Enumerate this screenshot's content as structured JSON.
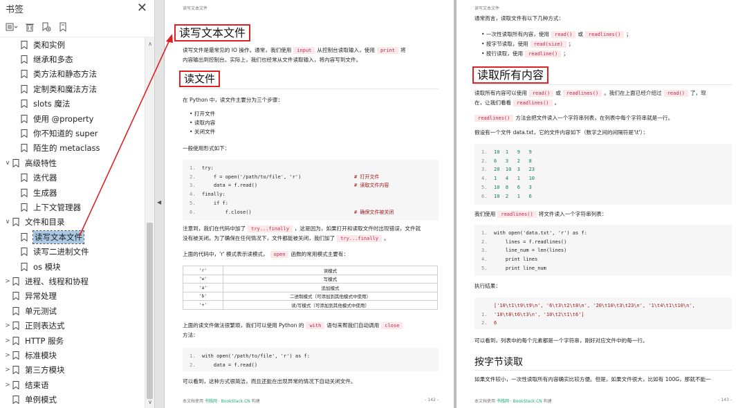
{
  "sidebar": {
    "title": "书签",
    "items": [
      {
        "label": "类和实例",
        "level": 1,
        "twisty": ""
      },
      {
        "label": "继承和多态",
        "level": 1,
        "twisty": ""
      },
      {
        "label": "类方法和静态方法",
        "level": 1,
        "twisty": ""
      },
      {
        "label": "定制类和魔法方法",
        "level": 1,
        "twisty": ""
      },
      {
        "label": "slots 魔法",
        "level": 1,
        "twisty": ""
      },
      {
        "label": "使用 @property",
        "level": 1,
        "twisty": ""
      },
      {
        "label": "你不知道的 super",
        "level": 1,
        "twisty": ""
      },
      {
        "label": "陌生的 metaclass",
        "level": 1,
        "twisty": ""
      },
      {
        "label": "高级特性",
        "level": 0,
        "twisty": "∨"
      },
      {
        "label": "迭代器",
        "level": 1,
        "twisty": ""
      },
      {
        "label": "生成器",
        "level": 1,
        "twisty": ""
      },
      {
        "label": "上下文管理器",
        "level": 1,
        "twisty": ""
      },
      {
        "label": "文件和目录",
        "level": 0,
        "twisty": "∨"
      },
      {
        "label": "读写文本文件",
        "level": 1,
        "twisty": "",
        "selected": true
      },
      {
        "label": "读写二进制文件",
        "level": 1,
        "twisty": ""
      },
      {
        "label": "os 模块",
        "level": 1,
        "twisty": ""
      },
      {
        "label": "进程、线程和协程",
        "level": 0,
        "twisty": ">"
      },
      {
        "label": "异常处理",
        "level": 0,
        "twisty": ""
      },
      {
        "label": "单元测试",
        "level": 0,
        "twisty": ""
      },
      {
        "label": "正则表达式",
        "level": 0,
        "twisty": ">"
      },
      {
        "label": "HTTP 服务",
        "level": 0,
        "twisty": ">"
      },
      {
        "label": "标准模块",
        "level": 0,
        "twisty": ">"
      },
      {
        "label": "第三方模块",
        "level": 0,
        "twisty": ">"
      },
      {
        "label": "结束语",
        "level": 0,
        "twisty": ">"
      },
      {
        "label": "单例模式",
        "level": 0,
        "twisty": ""
      }
    ]
  },
  "page1": {
    "header": "读写文本文件",
    "h1": "读写文本文件",
    "intro_a": "读写文件是最常见的 IO 操作。通常，我们使用",
    "intro_code1": "input",
    "intro_b": "从控制台读取输入，使用",
    "intro_code2": "print",
    "intro_c": "将",
    "intro_d": "内容输出到控制台。实际上，我们也经常从文件读取输入，将内容写到文件。",
    "h2": "读文件",
    "steps_intro": "在 Python 中，读文件主要分为三个步骤：",
    "steps": [
      "打开文件",
      "读取内容",
      "关闭文件"
    ],
    "general": "一般使用形式如下：",
    "code1": [
      {
        "n": "1.",
        "t": "try:"
      },
      {
        "n": "2.",
        "t": "    f = open('/path/to/file', 'r')",
        "c": "# 打开文件"
      },
      {
        "n": "3.",
        "t": "    data = f.read()",
        "c": "# 读取文件内容"
      },
      {
        "n": "4.",
        "t": "finally:"
      },
      {
        "n": "5.",
        "t": "    if f:"
      },
      {
        "n": "6.",
        "t": "        f.close()",
        "c": "# 确保文件被关闭"
      }
    ],
    "note_a": "注意到，我们在代码中加了",
    "note_code1": "try...finally",
    "note_b": "，这是因为，如果打开和读取文件时出现错误，文件就",
    "note_c": "没有被关闭。为了确保在任何情况下，文件都能被关闭，我们加了",
    "note_code2": "try...finally",
    "note_d": "。",
    "mode_a": "上面的代码中，'r' 模式表示读模式，",
    "mode_code": "open",
    "mode_b": "函数的常用模式主要有：",
    "table": [
      [
        "'r'",
        "读模式"
      ],
      [
        "'w'",
        "写模式"
      ],
      [
        "'a'",
        "追加模式"
      ],
      [
        "'b'",
        "二进制模式（可添加到其他模式中使用）"
      ],
      [
        "'+'",
        "读/写模式（可添加到其他模式中使用）"
      ]
    ],
    "with_a": "上面的读文件做法很繁琐，我们可以使用 Python 的",
    "with_code1": "with",
    "with_b": "语句来帮我们自动调用",
    "with_code2": "close",
    "with_c": "方法：",
    "code2": [
      {
        "n": "1.",
        "t": "with open('/path/to/file', 'r') as f:"
      },
      {
        "n": "2.",
        "t": "    data = f.read()"
      }
    ],
    "end": "可以看到，这种方式很简洁，而且还能在出现异常的情况下自动关闭文件。",
    "footer_a": "本文档使用",
    "footer_brand": "书栈网 · BookStack.CN",
    "footer_b": "构建",
    "page_no": "- 142 -"
  },
  "page2": {
    "header": "读写文本文件",
    "ways": "通常而言，读取文件有以下几种方式：",
    "w1a": "一次性读取所有内容，使用",
    "w1c1": "read()",
    "w1b": "或",
    "w1c2": "readlines()",
    "w1d": "；",
    "w2a": "按字节读取，使用",
    "w2c": "read(size)",
    "w2d": "；",
    "w3a": "按行读取，使用",
    "w3c": "readline()",
    "w3d": "；",
    "h2": "读取所有内容",
    "pa1": "读取所有内容可以使用",
    "pa_c1": "read()",
    "pa2": "或",
    "pa_c2": "readlines()",
    "pa3": "。我们在上面已经介绍过",
    "pa_c3": "read()",
    "pa4": "了，现",
    "pa5": "在，让我们看看",
    "pa_c4": "readlines()",
    "pa6": "。",
    "pb_c": "readlines()",
    "pb": "方法会把文件读入一个字符串列表，在列表中每个字符串就是一行。",
    "pc": "假设有一个文件 data.txt，它的文件内容如下（数字之间的间隔符是'\\t'）：",
    "data": [
      {
        "n": "1.",
        "t": "10  1   9   9"
      },
      {
        "n": "2.",
        "t": "6   3   2   8"
      },
      {
        "n": "3.",
        "t": "20  10  3   23"
      },
      {
        "n": "4.",
        "t": "1   4   1   10"
      },
      {
        "n": "5.",
        "t": "10  8   6   3"
      },
      {
        "n": "6.",
        "t": "10  2   1   6"
      }
    ],
    "pd_a": "我们使用",
    "pd_c": "readlines()",
    "pd_b": "将文件读入一个字符串列表：",
    "code": [
      {
        "n": "1.",
        "t": "with open('data.txt', 'r') as f:"
      },
      {
        "n": "2.",
        "t": "    lines = f.readlines()"
      },
      {
        "n": "3.",
        "t": "    line_num = len(lines)"
      },
      {
        "n": "4.",
        "t": "    print lines"
      },
      {
        "n": "5.",
        "t": "    print line_num"
      }
    ],
    "result": "执行结果：",
    "out0": "['10\\t1\\t9\\t9\\n', '6\\t3\\t2\\t8\\n', '20\\t10\\t3\\t23\\n', '1\\t4\\t1\\t10\\n',",
    "out": [
      {
        "n": "1.",
        "t": "'10\\t8\\t6\\t3\\n', '10\\t2\\t1\\t6']"
      },
      {
        "n": "2.",
        "t": "6"
      }
    ],
    "pe": "可以看到，列表中的每个元素都是一个字符串，刚好对应文件中的每一行。",
    "h3": "按字节读取",
    "pf": "如果文件较小，一次性读取所有内容确实比较方便。但是，如果文件很大，比如有 100G，那就不能一",
    "footer_a": "本文档使用",
    "footer_brand": "书栈网 · BookStack.CN",
    "footer_b": "构建",
    "page_no": "- 143 -"
  },
  "colors": {
    "highlight": "#e02020",
    "selection": "#a8c8e4"
  }
}
